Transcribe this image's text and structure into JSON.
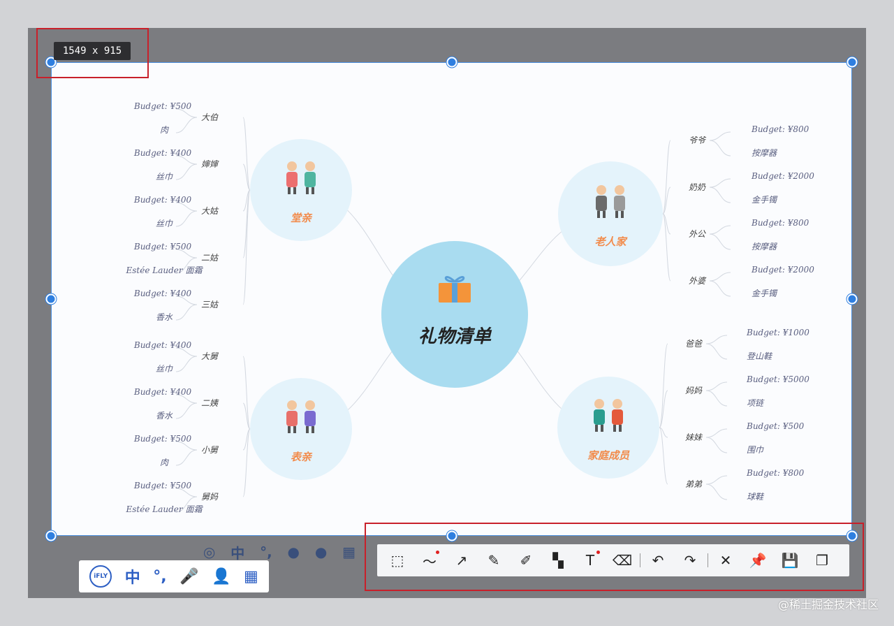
{
  "selection": {
    "size_label": "1549 x 915"
  },
  "mindmap": {
    "center": "礼物清单",
    "groups": [
      {
        "label": "堂亲",
        "side": "left",
        "members": [
          {
            "name": "大伯",
            "budget": "Budget: ¥500",
            "gift": "肉"
          },
          {
            "name": "婶婶",
            "budget": "Budget: ¥400",
            "gift": "丝巾"
          },
          {
            "name": "大姑",
            "budget": "Budget: ¥400",
            "gift": "丝巾"
          },
          {
            "name": "二姑",
            "budget": "Budget: ¥500",
            "gift": "Estée Lauder 面霜"
          },
          {
            "name": "三姑",
            "budget": "Budget: ¥400",
            "gift": "香水"
          }
        ]
      },
      {
        "label": "表亲",
        "side": "left",
        "members": [
          {
            "name": "大舅",
            "budget": "Budget: ¥400",
            "gift": "丝巾"
          },
          {
            "name": "二姨",
            "budget": "Budget: ¥400",
            "gift": "香水"
          },
          {
            "name": "小舅",
            "budget": "Budget: ¥500",
            "gift": "肉"
          },
          {
            "name": "舅妈",
            "budget": "Budget: ¥500",
            "gift": "Estée Lauder 面霜"
          }
        ]
      },
      {
        "label": "老人家",
        "side": "right",
        "members": [
          {
            "name": "爷爷",
            "budget": "Budget: ¥800",
            "gift": "按摩器"
          },
          {
            "name": "奶奶",
            "budget": "Budget: ¥2000",
            "gift": "金手镯"
          },
          {
            "name": "外公",
            "budget": "Budget: ¥800",
            "gift": "按摩器"
          },
          {
            "name": "外婆",
            "budget": "Budget: ¥2000",
            "gift": "金手镯"
          }
        ]
      },
      {
        "label": "家庭成员",
        "side": "right",
        "members": [
          {
            "name": "爸爸",
            "budget": "Budget: ¥1000",
            "gift": "登山鞋"
          },
          {
            "name": "妈妈",
            "budget": "Budget: ¥5000",
            "gift": "项链"
          },
          {
            "name": "妹妹",
            "budget": "Budget: ¥500",
            "gift": "围巾"
          },
          {
            "name": "弟弟",
            "budget": "Budget: ¥800",
            "gift": "球鞋"
          }
        ]
      }
    ]
  },
  "toolbar": {
    "tools": [
      {
        "icon": "rectangle-shape-icon",
        "glyph": "⬚",
        "dot": false
      },
      {
        "icon": "freehand-line-icon",
        "glyph": "〜",
        "dot": true
      },
      {
        "icon": "arrow-icon",
        "glyph": "↗",
        "dot": false
      },
      {
        "icon": "pencil-icon",
        "glyph": "✎",
        "dot": false
      },
      {
        "icon": "highlighter-icon",
        "glyph": "✐",
        "dot": false
      },
      {
        "icon": "mosaic-icon",
        "glyph": "▚",
        "dot": false
      },
      {
        "icon": "text-icon",
        "glyph": "T",
        "dot": true
      },
      {
        "icon": "eraser-icon",
        "glyph": "⌫",
        "dot": false
      },
      {
        "sep": true
      },
      {
        "icon": "undo-icon",
        "glyph": "↶",
        "dot": false
      },
      {
        "icon": "redo-icon",
        "glyph": "↷",
        "dot": false
      },
      {
        "sep": true
      },
      {
        "icon": "close-icon",
        "glyph": "✕",
        "dot": false
      },
      {
        "icon": "pin-icon",
        "glyph": "📌",
        "dot": false
      },
      {
        "icon": "save-icon",
        "glyph": "💾",
        "dot": false
      },
      {
        "icon": "copy-icon",
        "glyph": "❐",
        "dot": false
      }
    ]
  },
  "ime": {
    "items": [
      {
        "icon": "ime-logo-icon",
        "glyph": "iFLY"
      },
      {
        "icon": "chinese-mode-icon",
        "glyph": "中"
      },
      {
        "icon": "punctuation-icon",
        "glyph": "°,"
      },
      {
        "icon": "microphone-icon",
        "glyph": "🎤"
      },
      {
        "icon": "user-icon",
        "glyph": "👤"
      },
      {
        "icon": "apps-grid-icon",
        "glyph": "▦"
      }
    ]
  },
  "watermark": "@稀土掘金技术社区"
}
